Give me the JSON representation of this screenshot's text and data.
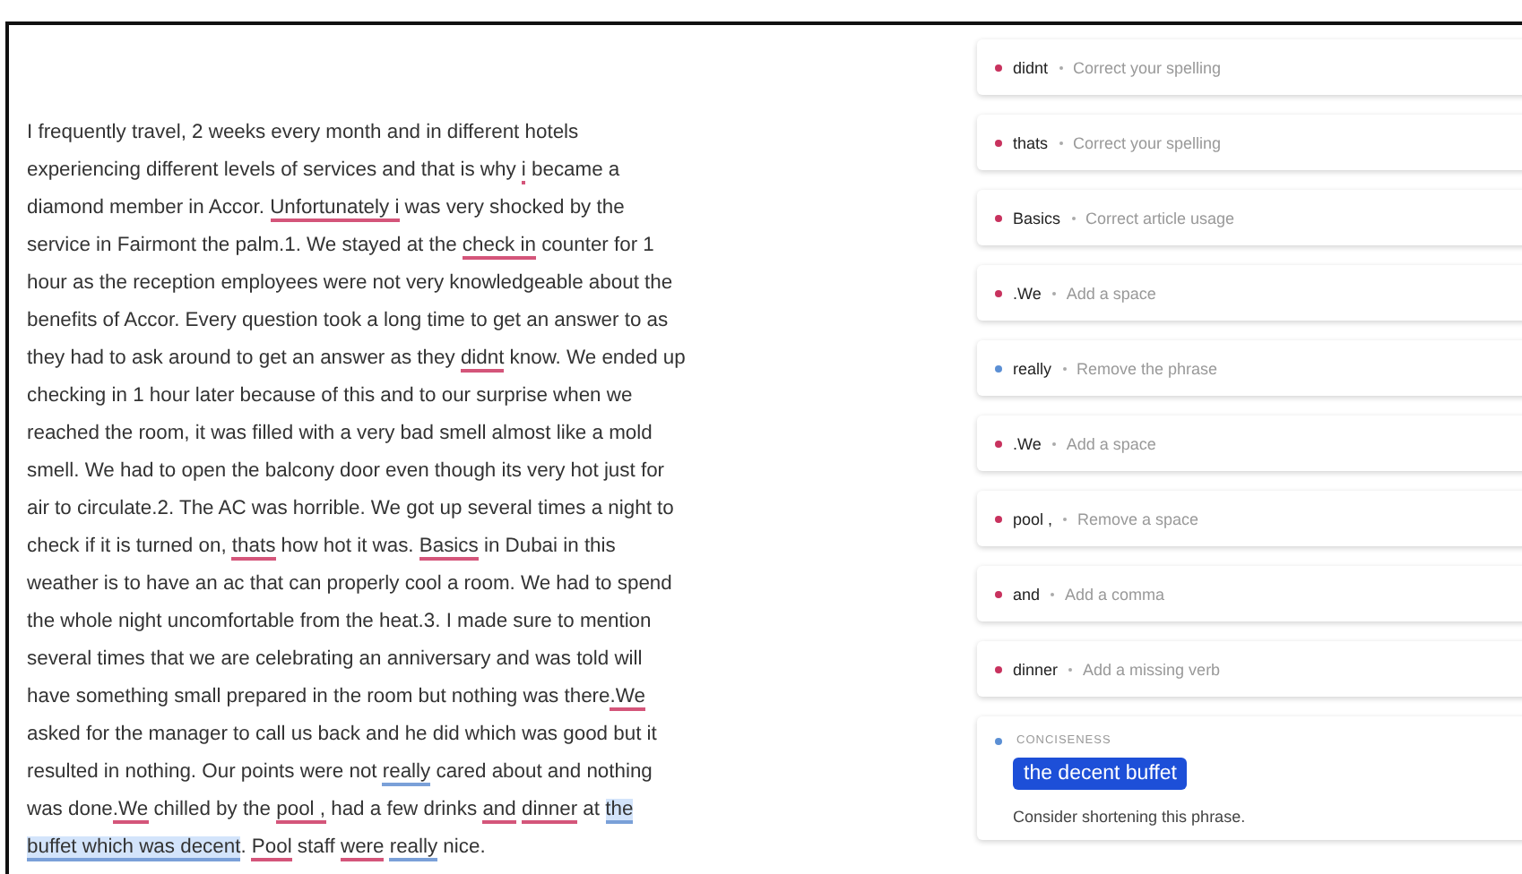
{
  "essay": {
    "segments": [
      {
        "text": "I frequently travel, 2 weeks every month and in different hotels experiencing different levels of services and that is why ",
        "kind": "plain"
      },
      {
        "text": "i",
        "kind": "spelling"
      },
      {
        "text": " became a diamond member in Accor. ",
        "kind": "plain"
      },
      {
        "text": "Unfortunately i",
        "kind": "spelling"
      },
      {
        "text": " was very shocked by the service in Fairmont the palm.1. We stayed at the ",
        "kind": "plain"
      },
      {
        "text": "check in",
        "kind": "spelling"
      },
      {
        "text": " counter for 1 hour as the reception employees were not very knowledgeable about the benefits of Accor. Every question took a long time to get an answer to as they had to ask around to get an answer as they ",
        "kind": "plain"
      },
      {
        "text": "didnt",
        "kind": "spelling"
      },
      {
        "text": " know. We ended up checking in 1 hour later because of this and to our surprise when we reached the room, it was filled with a very bad smell almost like a mold smell. We had to open the balcony door even though its very hot just for air to circulate.2. The AC was horrible. We got up several times a night to check if it is turned on, ",
        "kind": "plain"
      },
      {
        "text": "thats",
        "kind": "spelling"
      },
      {
        "text": " how hot it was. ",
        "kind": "plain"
      },
      {
        "text": "Basics",
        "kind": "spelling"
      },
      {
        "text": " in Dubai in this weather is to have an ac that can properly cool a room. We had to spend the whole night uncomfortable from the heat.3. I made sure to mention several times that we are celebrating an anniversary and was told will have something small prepared in the room but nothing was there",
        "kind": "plain"
      },
      {
        "text": ".We",
        "kind": "spelling"
      },
      {
        "text": " asked for the manager to call us back and he did which was good but it resulted in nothing. Our points were not ",
        "kind": "plain"
      },
      {
        "text": "really",
        "kind": "clarity"
      },
      {
        "text": " cared about and nothing was done",
        "kind": "plain"
      },
      {
        "text": ".We",
        "kind": "spelling"
      },
      {
        "text": " chilled by the ",
        "kind": "plain"
      },
      {
        "text": "pool ,",
        "kind": "spelling"
      },
      {
        "text": " had a few drinks ",
        "kind": "plain"
      },
      {
        "text": "and ",
        "kind": "spelling"
      },
      {
        "text": "dinner",
        "kind": "spelling"
      },
      {
        "text": " at ",
        "kind": "plain"
      },
      {
        "text": "the buffet which was decent",
        "kind": "highlight"
      },
      {
        "text": ". ",
        "kind": "plain"
      },
      {
        "text": "Pool",
        "kind": "spelling"
      },
      {
        "text": " staff ",
        "kind": "plain"
      },
      {
        "text": "were ",
        "kind": "spelling"
      },
      {
        "text": "really",
        "kind": "clarity"
      },
      {
        "text": " nice.",
        "kind": "plain"
      }
    ]
  },
  "suggestions": [
    {
      "kind": "brief",
      "word": "didnt",
      "advice": "Correct your spelling",
      "color": "#c8325e"
    },
    {
      "kind": "brief",
      "word": "thats",
      "advice": "Correct your spelling",
      "color": "#c8325e"
    },
    {
      "kind": "brief",
      "word": "Basics",
      "advice": "Correct article usage",
      "color": "#c8325e"
    },
    {
      "kind": "brief",
      "word": ".We",
      "advice": "Add a space",
      "color": "#c8325e"
    },
    {
      "kind": "brief",
      "word": "really",
      "advice": "Remove the phrase",
      "color": "#5b8fd4"
    },
    {
      "kind": "brief",
      "word": ".We",
      "advice": "Add a space",
      "color": "#c8325e"
    },
    {
      "kind": "brief",
      "word": "pool ,",
      "advice": "Remove a space",
      "color": "#c8325e"
    },
    {
      "kind": "brief",
      "word": "and",
      "advice": "Add a comma",
      "color": "#c8325e"
    },
    {
      "kind": "brief",
      "word": "dinner",
      "advice": "Add a missing verb",
      "color": "#c8325e"
    },
    {
      "kind": "expanded",
      "category": "CONCISENESS",
      "replacement": "the decent buffet",
      "advice": "Consider shortening this phrase.",
      "color": "#5b8fd4"
    }
  ]
}
